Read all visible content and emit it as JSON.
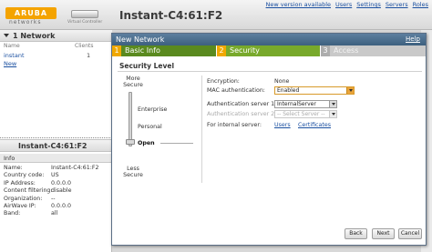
{
  "header": {
    "logo_text": "ARUBA",
    "logo_sub": "networks",
    "virtual_controller_label": "Virtual Controller",
    "title": "Instant-C4:61:F2",
    "links": [
      "New version available",
      "Users",
      "Settings",
      "Servers",
      "Roles"
    ]
  },
  "networks_panel": {
    "title": "1 Network",
    "col_name": "Name",
    "col_clients": "Clients",
    "rows": [
      {
        "name": "instant",
        "clients": "1"
      }
    ],
    "new_link": "New"
  },
  "ap_panel": {
    "title": "Instant-C4:61:F2",
    "info_header": "Info",
    "info": [
      {
        "k": "Name:",
        "v": "Instant-C4:61:F2"
      },
      {
        "k": "Country code:",
        "v": "US"
      },
      {
        "k": "IP Address:",
        "v": "0.0.0.0"
      },
      {
        "k": "Content filtering:",
        "v": "disable"
      },
      {
        "k": "Organization:",
        "v": "--"
      },
      {
        "k": "AirWave IP:",
        "v": "0.0.0.0"
      },
      {
        "k": "Band:",
        "v": "all"
      }
    ]
  },
  "dialog": {
    "title": "New Network",
    "help": "Help",
    "steps": [
      {
        "num": "1",
        "label": "Basic Info",
        "state": "done"
      },
      {
        "num": "2",
        "label": "Security",
        "state": "active"
      },
      {
        "num": "3",
        "label": "Access",
        "state": "pending"
      }
    ],
    "section_title": "Security Level",
    "slider": {
      "top_label": "More Secure",
      "bottom_label": "Less Secure",
      "levels": [
        "Enterprise",
        "Personal",
        "Open"
      ],
      "selected": "Open"
    },
    "form": {
      "encryption_label": "Encryption:",
      "encryption_value": "None",
      "mac_auth_label": "MAC authentication:",
      "mac_auth_value": "Enabled",
      "auth_server1_label": "Authentication server 1:",
      "auth_server1_value": "InternalServer",
      "auth_server2_label": "Authentication server 2:",
      "auth_server2_value": "-- Select Server --",
      "internal_server_label": "For internal server:",
      "users_link": "Users",
      "certificates_link": "Certificates"
    },
    "buttons": {
      "back": "Back",
      "next": "Next",
      "cancel": "Cancel"
    }
  },
  "colors": {
    "title_bar": "#3d607f",
    "step_done": "#5a8a1f",
    "step_active": "#78a92b",
    "step_pending": "#c9c9c9",
    "accent": "#f0a800"
  }
}
